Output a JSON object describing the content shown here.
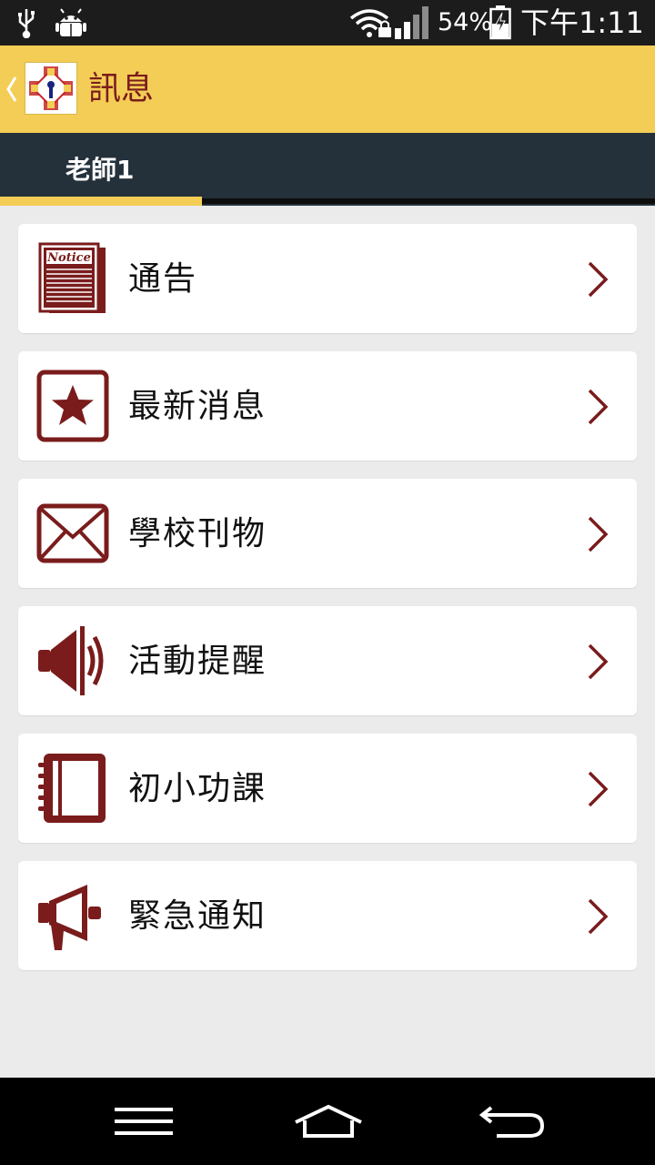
{
  "status_bar": {
    "battery_percent": "54%",
    "time": "下午1:11"
  },
  "app_bar": {
    "title": "訊息"
  },
  "tabs": [
    {
      "label": "老師1",
      "selected": true
    }
  ],
  "menu": {
    "items": [
      {
        "label": "通告",
        "icon": "notice-icon"
      },
      {
        "label": "最新消息",
        "icon": "star-icon"
      },
      {
        "label": "學校刊物",
        "icon": "envelope-icon"
      },
      {
        "label": "活動提醒",
        "icon": "speaker-icon"
      },
      {
        "label": "初小功課",
        "icon": "notebook-icon"
      },
      {
        "label": "緊急通知",
        "icon": "megaphone-icon"
      }
    ]
  },
  "notice_icon_text": "Notice",
  "colors": {
    "accent_yellow": "#f3cd55",
    "brand_maroon": "#7a1c1c",
    "tab_bar_dark": "#24313b",
    "background": "#ebebeb"
  }
}
